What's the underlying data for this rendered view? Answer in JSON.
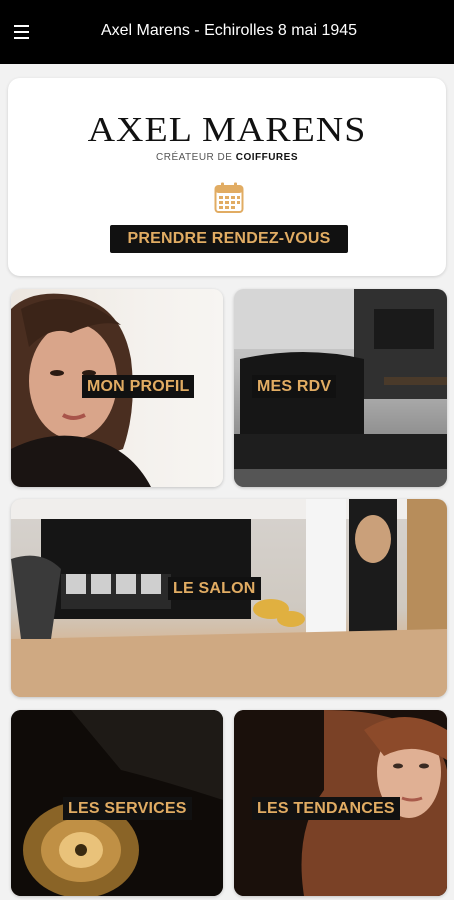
{
  "app_bar": {
    "title": "Axel Marens - Echirolles 8 mai 1945",
    "menu_icon": "hamburger-menu-icon"
  },
  "hero": {
    "logo_text": "AXEL MARENS",
    "tagline_prefix": "CRÉATEUR DE",
    "tagline_bold": "COIFFURES",
    "calendar_icon": "calendar-icon",
    "cta_label": "PRENDRE RENDEZ-VOUS",
    "accent_color": "#e1ac63"
  },
  "tiles": {
    "profil": {
      "label": "MON PROFIL"
    },
    "rdv": {
      "label": "MES RDV"
    },
    "salon": {
      "label": "LE SALON"
    },
    "services": {
      "label": "LES SERVICES"
    },
    "tendances": {
      "label": "LES TENDANCES"
    }
  }
}
